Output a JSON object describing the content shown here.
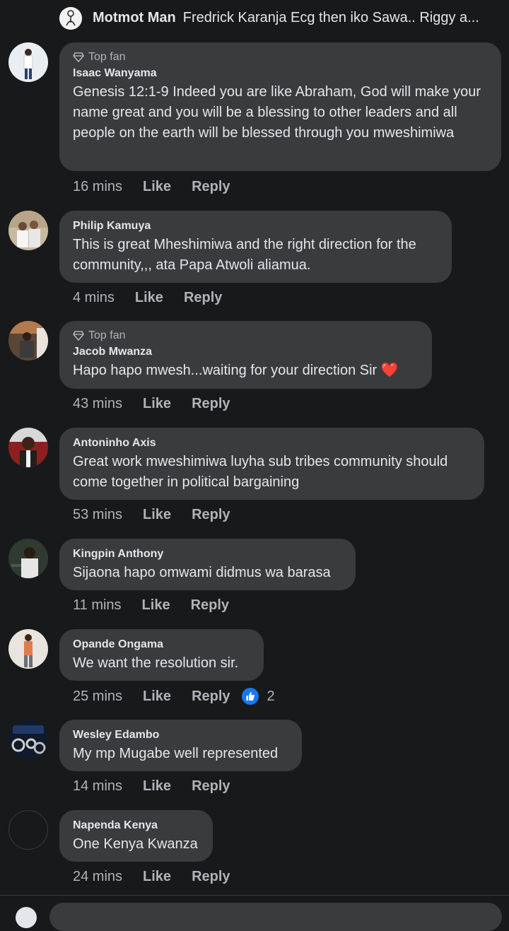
{
  "top_reply": {
    "author": "Motmot Man",
    "snippet": "Fredrick Karanja Ecg then iko Sawa.. Riggy a..."
  },
  "actions": {
    "like": "Like",
    "reply": "Reply"
  },
  "comments": [
    {
      "badge": "Top fan",
      "author": "Isaac Wanyama",
      "text": "Genesis 12:1-9 Indeed you are like Abraham, God will make your name great and you will be a blessing to other leaders and all people on the earth will be blessed through you mweshimiwa",
      "time": "16 mins"
    },
    {
      "badge": "",
      "author": "Philip Kamuya",
      "text": "This is great Mheshimiwa and the right direction for the community,,, ata Papa Atwoli aliamua.",
      "time": "4 mins"
    },
    {
      "badge": "Top fan",
      "author": "Jacob Mwanza",
      "text": "Hapo hapo mwesh...waiting for your direction Sir ❤️",
      "time": "43 mins"
    },
    {
      "badge": "",
      "author": "Antoninho Axis",
      "text": "Great work mweshimiwa luyha sub tribes community should come together in political bargaining",
      "time": "53 mins"
    },
    {
      "badge": "",
      "author": "Kingpin Anthony",
      "text": "Sijaona hapo omwami didmus wa barasa",
      "time": "11 mins"
    },
    {
      "badge": "",
      "author": "Opande Ongama",
      "text": "We want the resolution sir.",
      "time": "25 mins",
      "reaction_count": "2"
    },
    {
      "badge": "",
      "author": "Wesley Edambo",
      "text": "My mp Mugabe well represented",
      "time": "14 mins"
    },
    {
      "badge": "",
      "author": "Napenda Kenya",
      "text": "One Kenya Kwanza",
      "time": "24 mins"
    }
  ],
  "colors": {
    "background": "#18191a",
    "bubble": "#3a3b3c",
    "text": "#e4e6eb",
    "muted": "#b0b3b8",
    "like_blue": "#1877f2"
  }
}
